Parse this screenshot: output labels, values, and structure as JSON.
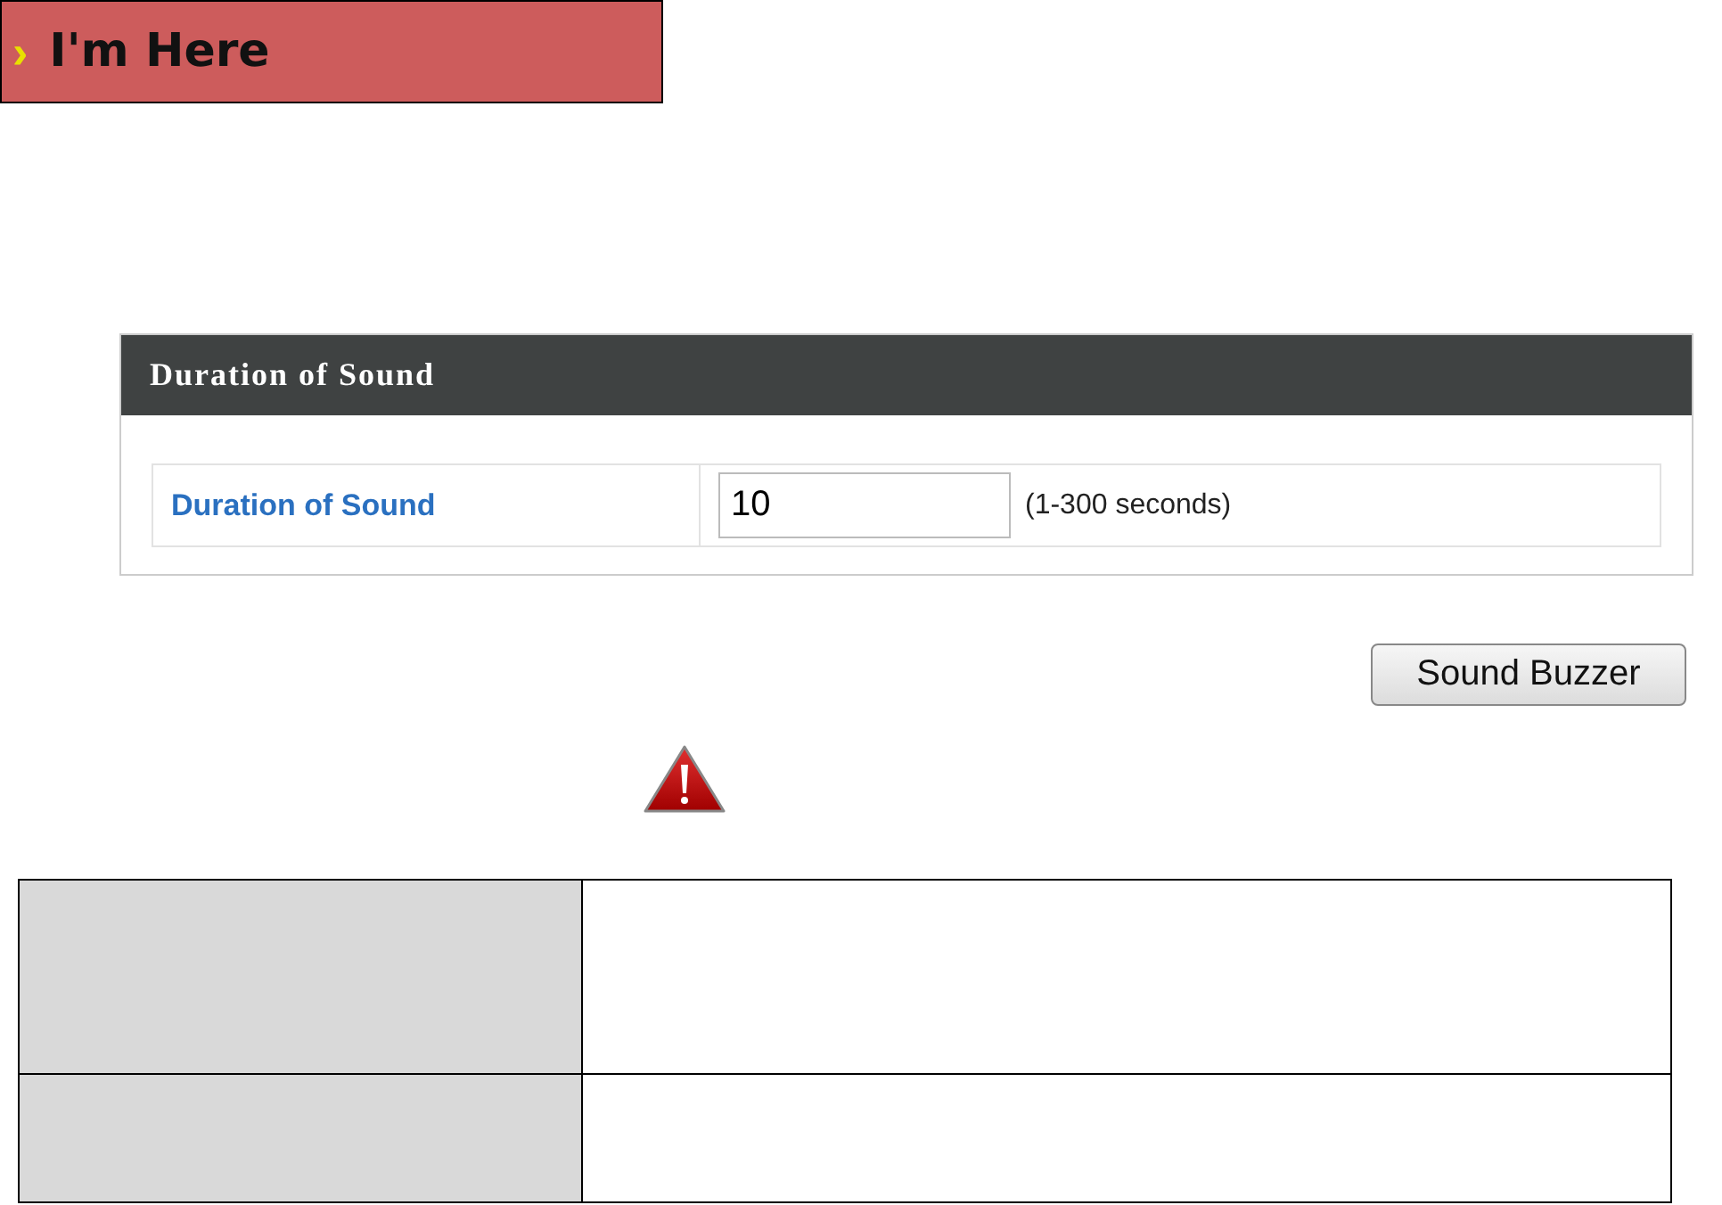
{
  "banner": {
    "arrow": "›",
    "title": "I'm Here"
  },
  "panel": {
    "title": "Duration of Sound",
    "fields": [
      {
        "label": "Duration of Sound",
        "value": "10",
        "hint": "(1-300 seconds)"
      }
    ]
  },
  "button": "Sound Buzzer",
  "table": {
    "rows": [
      {
        "kind": "tall"
      },
      {
        "kind": "short"
      }
    ]
  }
}
